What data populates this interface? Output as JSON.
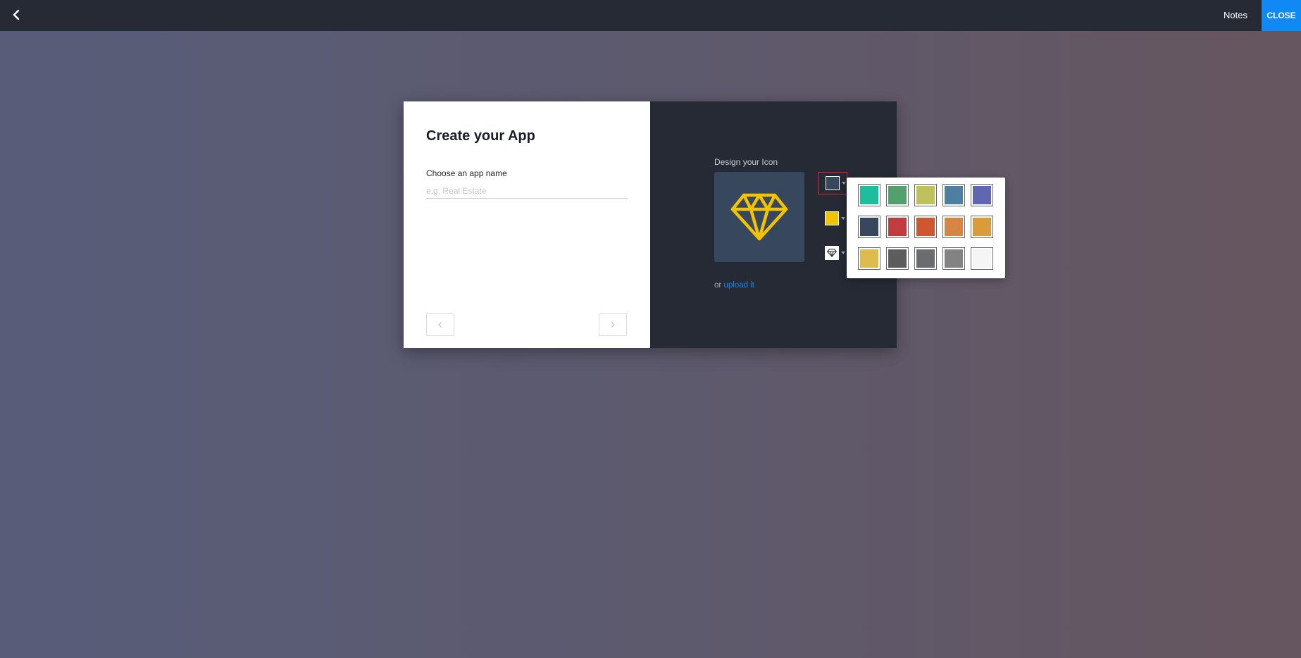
{
  "topbar": {
    "back_icon": "chevron-left-icon",
    "notes_label": "Notes",
    "close_label": "CLOSE"
  },
  "form": {
    "title": "Create your App",
    "name_label": "Choose an app name",
    "name_placeholder": "e.g. Real Estate",
    "name_value": "",
    "prev_icon": "chevron-left-icon",
    "next_icon": "chevron-right-icon"
  },
  "design": {
    "label": "Design your Icon",
    "preview_icon": "diamond-icon",
    "preview_background": "#37475d",
    "preview_icon_color": "#f3c300",
    "background_color": "#37475d",
    "icon_color": "#f3c300",
    "glyph_icon": "diamond-icon",
    "upload_prefix": "or",
    "upload_link": "upload it"
  },
  "palette": {
    "colors": [
      "#1dbd9d",
      "#53a06f",
      "#bdc25b",
      "#4e7fa3",
      "#5f68ae",
      "#37475d",
      "#c13c3f",
      "#d05630",
      "#d68644",
      "#d99c39",
      "#ddbb4c",
      "#5c5c5c",
      "#6a6c70",
      "#838383",
      "#f5f5f5"
    ]
  }
}
